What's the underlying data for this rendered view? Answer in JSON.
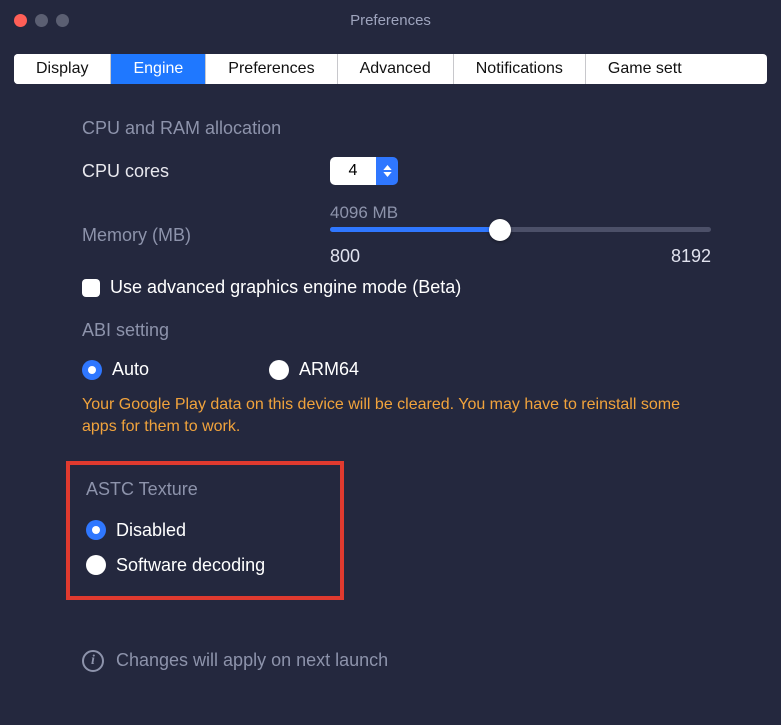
{
  "window": {
    "title": "Preferences"
  },
  "tabs": {
    "t0": "Display",
    "t1": "Engine",
    "t2": "Preferences",
    "t3": "Advanced",
    "t4": "Notifications",
    "t5": "Game sett"
  },
  "engine": {
    "cpu_section": "CPU and RAM allocation",
    "cpu_label": "CPU cores",
    "cpu_value": "4",
    "mem_label": "Memory (MB)",
    "mem_value": "4096 MB",
    "mem_min": "800",
    "mem_max": "8192",
    "adv_gfx": "Use advanced graphics engine mode (Beta)",
    "abi_section": "ABI setting",
    "abi_auto": "Auto",
    "abi_arm64": "ARM64",
    "abi_warn": "Your Google Play data on this device will be cleared. You may have to reinstall some apps for them to work.",
    "astc_section": "ASTC Texture",
    "astc_disabled": "Disabled",
    "astc_sw": "Software decoding",
    "info_text": "Changes will apply on next launch"
  }
}
